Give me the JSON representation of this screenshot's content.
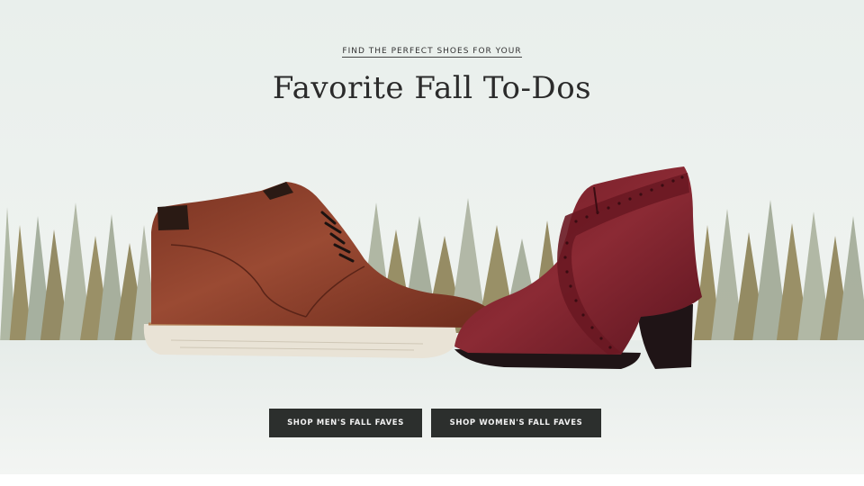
{
  "hero": {
    "eyebrow": "FIND THE PERFECT SHOES FOR YOUR",
    "headline": "Favorite Fall To-Dos"
  },
  "buttons": {
    "men": "SHOP MEN'S FALL FAVES",
    "women": "SHOP WOMEN'S FALL FAVES"
  },
  "colors": {
    "cta_background": "#2c2f2d",
    "cta_text": "#f2f2f2",
    "background": "#eaf0ed",
    "tree_olive": "#8b7e4e",
    "tree_sage": "#9aa592",
    "mens_shoe": "#8a3c2a",
    "womens_boot": "#7a1f2a"
  },
  "icons": [
    "mens-chukka-boot",
    "womens-ankle-bootie",
    "pine-tree-line"
  ]
}
